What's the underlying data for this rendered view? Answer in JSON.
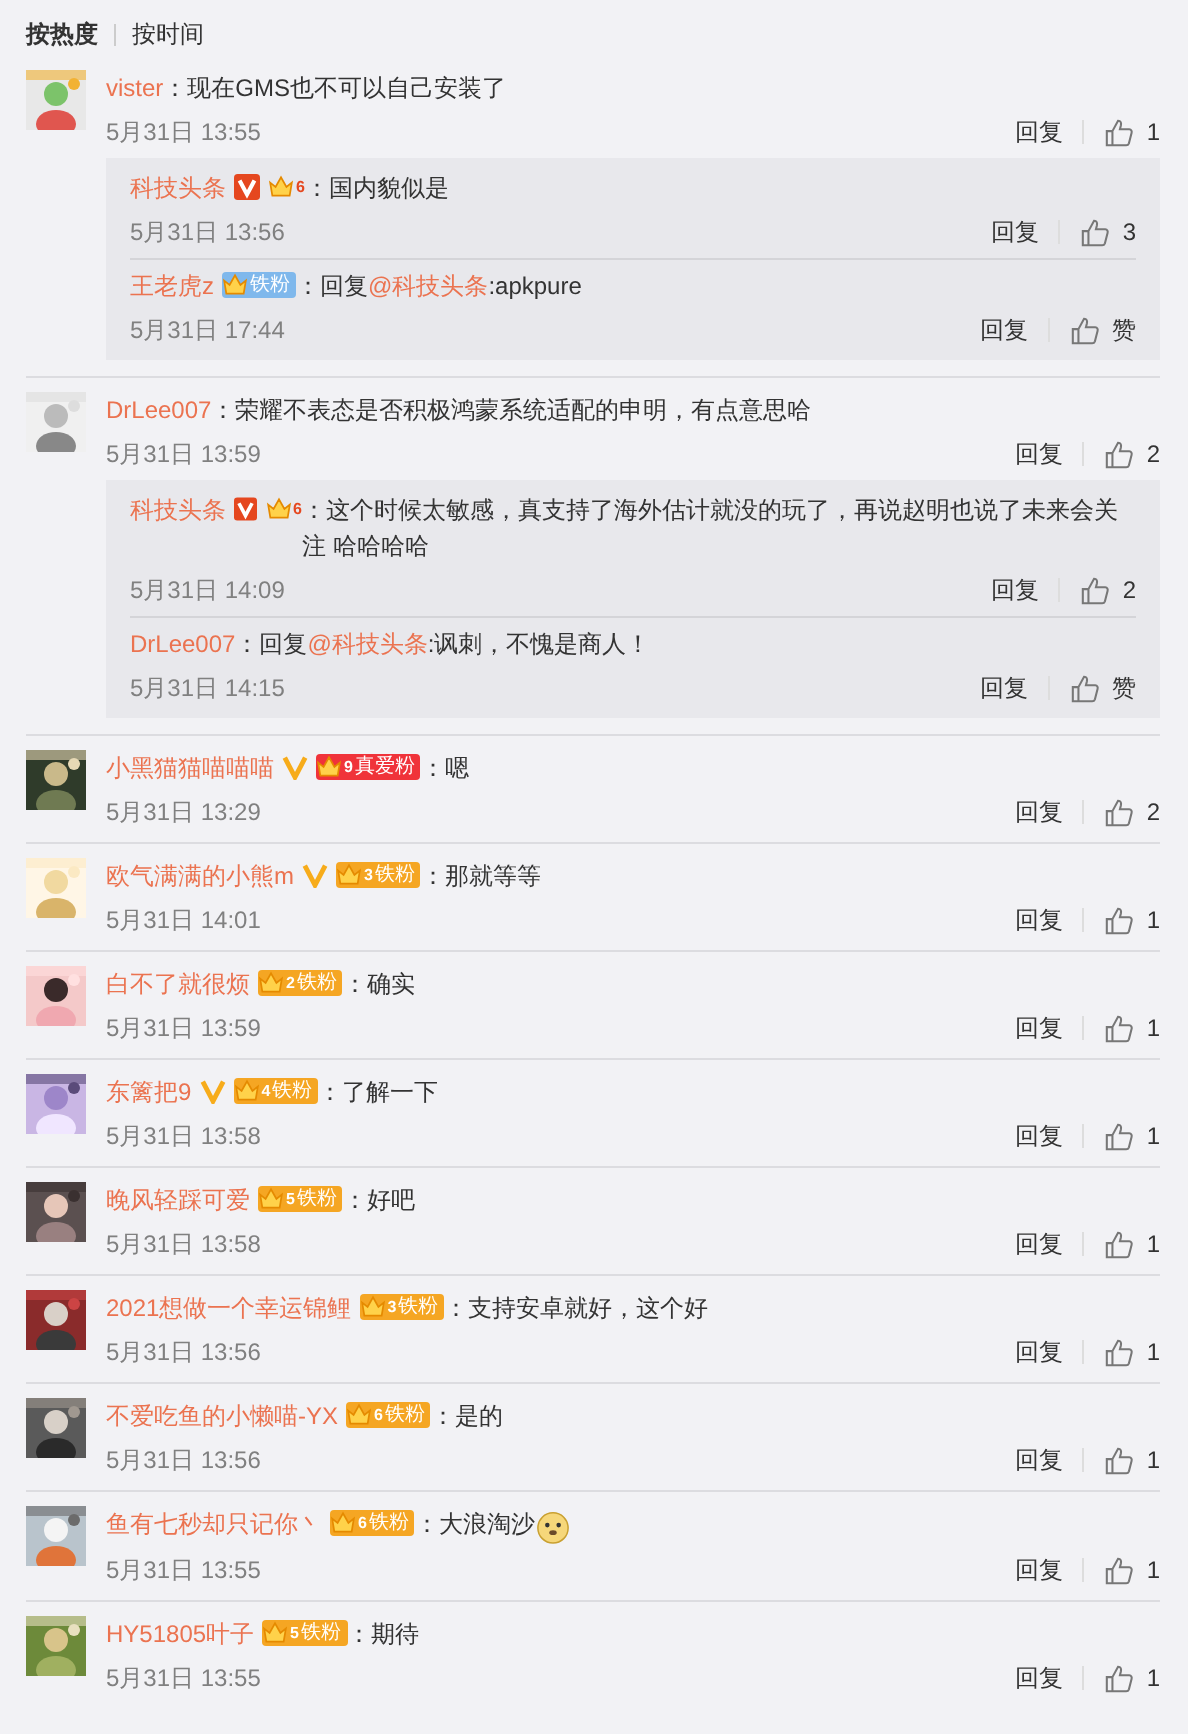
{
  "sort_tabs": [
    {
      "label": "按热度",
      "selected": true
    },
    {
      "label": "按时间",
      "selected": false
    }
  ],
  "comments": [
    {
      "user": "vister",
      "text": "：现在GMS也不可以自己安装了",
      "time": "5月31日 13:55",
      "reply": "回复",
      "likes": "1",
      "replies": [
        {
          "user": "科技头条",
          "verified": true,
          "org_account": true,
          "badge": {
            "level": "6"
          },
          "text": "：国内貌似是",
          "time": "5月31日 13:56",
          "reply": "回复",
          "likes": "3"
        },
        {
          "user": "王老虎z",
          "badge": {
            "label": "铁粉",
            "color": "#7fb8ec"
          },
          "text": "：回复",
          "mention": "@科技头条",
          "text_after": ":apkpure",
          "time": "5月31日 17:44",
          "reply": "回复",
          "likes": "赞"
        }
      ]
    },
    {
      "user": "DrLee007",
      "text": "：荣耀不表态是否积极鸿蒙系统适配的申明，有点意思哈",
      "time": "5月31日 13:59",
      "reply": "回复",
      "likes": "2",
      "replies": [
        {
          "user": "科技头条",
          "verified": true,
          "org_account": true,
          "badge": {
            "level": "6"
          },
          "text": "：这个时候太敏感，真支持了海外估计就没的玩了，再说赵明也说了未来会关注 哈哈哈哈",
          "time": "5月31日 14:09",
          "reply": "回复",
          "likes": "2"
        },
        {
          "user": "DrLee007",
          "text": "：回复",
          "mention": "@科技头条",
          "text_after": ":讽刺，不愧是商人！",
          "time": "5月31日 14:15",
          "reply": "回复",
          "likes": "赞"
        }
      ]
    },
    {
      "user": "小黑猫猫喵喵喵",
      "verified": true,
      "badge": {
        "level": "9",
        "label": "真爱粉",
        "color": "#f0333a"
      },
      "text": "：嗯",
      "time": "5月31日 13:29",
      "reply": "回复",
      "likes": "2"
    },
    {
      "user": "欧气满满的小熊m",
      "verified": true,
      "badge": {
        "level": "3",
        "label": "铁粉",
        "color": "#f5a623"
      },
      "text": "：那就等等",
      "time": "5月31日 14:01",
      "reply": "回复",
      "likes": "1"
    },
    {
      "user": "白不了就很烦",
      "badge": {
        "level": "2",
        "label": "铁粉",
        "color": "#f5a623"
      },
      "text": "：确实",
      "time": "5月31日 13:59",
      "reply": "回复",
      "likes": "1"
    },
    {
      "user": "东篱把9",
      "verified": true,
      "badge": {
        "level": "4",
        "label": "铁粉",
        "color": "#f5a623"
      },
      "text": "：了解一下",
      "time": "5月31日 13:58",
      "reply": "回复",
      "likes": "1"
    },
    {
      "user": "晚风轻踩可爱",
      "badge": {
        "level": "5",
        "label": "铁粉",
        "color": "#f5a623"
      },
      "text": "：好吧",
      "time": "5月31日 13:58",
      "reply": "回复",
      "likes": "1"
    },
    {
      "user": "2021想做一个幸运锦鲤",
      "badge": {
        "level": "3",
        "label": "铁粉",
        "color": "#f5a623"
      },
      "text": "：支持安卓就好，这个好",
      "time": "5月31日 13:56",
      "reply": "回复",
      "likes": "1"
    },
    {
      "user": "不爱吃鱼的小懒喵-YX",
      "badge": {
        "level": "6",
        "label": "铁粉",
        "color": "#f5a623"
      },
      "text": "：是的",
      "time": "5月31日 13:56",
      "reply": "回复",
      "likes": "1"
    },
    {
      "user": "鱼有七秒却只记你丶",
      "badge": {
        "level": "6",
        "label": "铁粉",
        "color": "#f5a623"
      },
      "text": "：大浪淘沙",
      "emoji": true,
      "time": "5月31日 13:55",
      "reply": "回复",
      "likes": "1"
    },
    {
      "user": "HY51805叶子",
      "badge": {
        "level": "5",
        "label": "铁粉",
        "color": "#f5a623"
      },
      "text": "：期待",
      "time": "5月31日 13:55",
      "reply": "回复",
      "likes": "1"
    }
  ]
}
